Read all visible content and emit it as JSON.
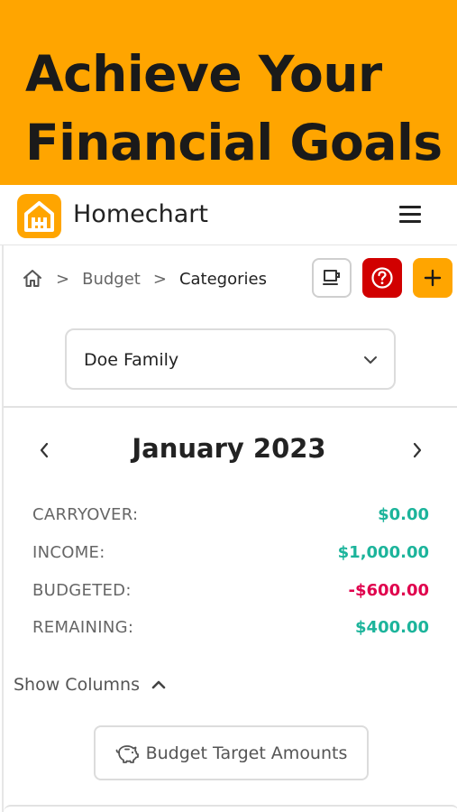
{
  "banner": {
    "line1": "Achieve Your",
    "line2": "Financial Goals"
  },
  "app": {
    "title": "Homechart",
    "brand_color": "#FFA500"
  },
  "breadcrumb": {
    "items": [
      "Budget",
      "Categories"
    ],
    "separator": ">"
  },
  "actions": {
    "coffee_icon": "coffee-icon",
    "help_icon": "help-icon",
    "add_icon": "plus-icon",
    "help_color": "#D10000"
  },
  "account_select": {
    "value": "Doe Family"
  },
  "month": {
    "title": "January 2023"
  },
  "summary": [
    {
      "label": "CARRYOVER:",
      "value": "$0.00",
      "color": "#1CB49B"
    },
    {
      "label": "INCOME:",
      "value": "$1,000.00",
      "color": "#1CB49B"
    },
    {
      "label": "BUDGETED:",
      "value": "-$600.00",
      "color": "#E0004D"
    },
    {
      "label": "REMAINING:",
      "value": "$400.00",
      "color": "#1CB49B"
    }
  ],
  "show_columns": {
    "label": "Show Columns"
  },
  "target_button": {
    "label": "Budget Target Amounts",
    "icon": "piggy-bank-icon"
  }
}
